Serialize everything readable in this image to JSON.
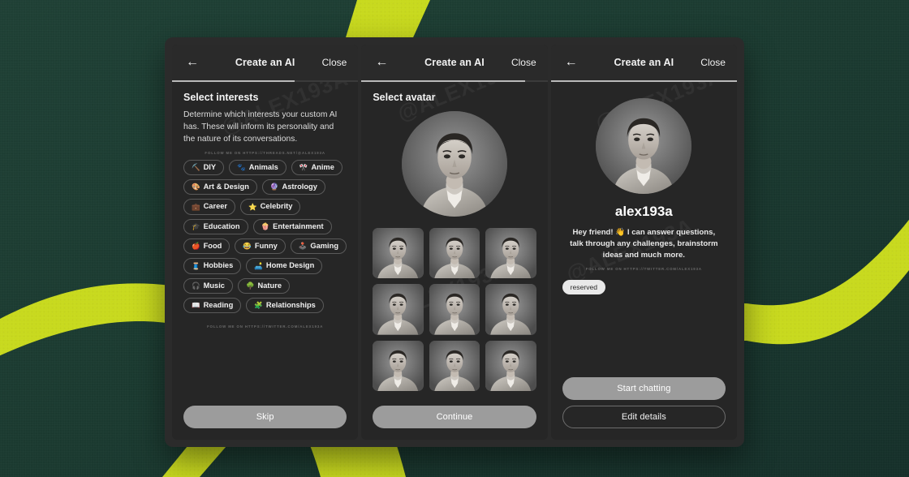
{
  "background": {
    "color": "#1d3b32",
    "ribbon_color": "#c8d91e"
  },
  "watermarks": {
    "threads": "FOLLOW ME ON HTTPS://THREADS.NET/@ALEX193A",
    "twitter": "FOLLOW ME ON HTTPS://TWITTER.COM/ALEX193A",
    "handle": "@ALEX193A"
  },
  "screens": [
    {
      "header": {
        "back_icon": "arrow-left-icon",
        "back_glyph": "←",
        "title": "Create an AI",
        "close_label": "Close"
      },
      "progress_percent": 66,
      "section_title": "Select interests",
      "section_desc": "Determine which interests your custom AI has. These will inform its personality and the nature of its conversations.",
      "interests": [
        {
          "emoji": "⛏️",
          "label": "DIY",
          "icon": "diy-icon"
        },
        {
          "emoji": "🐾",
          "label": "Animals",
          "icon": "animals-icon"
        },
        {
          "emoji": "🎌",
          "label": "Anime",
          "icon": "anime-icon"
        },
        {
          "emoji": "🎨",
          "label": "Art & Design",
          "icon": "art-design-icon"
        },
        {
          "emoji": "🔮",
          "label": "Astrology",
          "icon": "astrology-icon"
        },
        {
          "emoji": "💼",
          "label": "Career",
          "icon": "career-icon"
        },
        {
          "emoji": "⭐",
          "label": "Celebrity",
          "icon": "celebrity-icon"
        },
        {
          "emoji": "🎓",
          "label": "Education",
          "icon": "education-icon"
        },
        {
          "emoji": "🍿",
          "label": "Entertainment",
          "icon": "entertainment-icon"
        },
        {
          "emoji": "🍎",
          "label": "Food",
          "icon": "food-icon"
        },
        {
          "emoji": "😂",
          "label": "Funny",
          "icon": "funny-icon"
        },
        {
          "emoji": "🕹️",
          "label": "Gaming",
          "icon": "gaming-icon"
        },
        {
          "emoji": "🧵",
          "label": "Hobbies",
          "icon": "hobbies-icon"
        },
        {
          "emoji": "🛋️",
          "label": "Home Design",
          "icon": "home-design-icon"
        },
        {
          "emoji": "🎧",
          "label": "Music",
          "icon": "music-icon"
        },
        {
          "emoji": "🌳",
          "label": "Nature",
          "icon": "nature-icon"
        },
        {
          "emoji": "📖",
          "label": "Reading",
          "icon": "reading-icon"
        },
        {
          "emoji": "🧩",
          "label": "Relationships",
          "icon": "relationships-icon"
        }
      ],
      "primary_button": "Skip"
    },
    {
      "header": {
        "back_icon": "arrow-left-icon",
        "back_glyph": "←",
        "title": "Create an AI",
        "close_label": "Close"
      },
      "progress_percent": 88,
      "section_title": "Select avatar",
      "avatar_count": 9,
      "primary_button": "Continue"
    },
    {
      "header": {
        "back_icon": "arrow-left-icon",
        "back_glyph": "←",
        "title": "Create an AI",
        "close_label": "Close"
      },
      "progress_percent": 100,
      "profile_name": "alex193a",
      "profile_bio": "Hey friend! 👋 I can answer questions, talk through any challenges, brainstorm ideas and much more.",
      "badge_label": "reserved",
      "primary_button": "Start chatting",
      "secondary_button": "Edit details"
    }
  ]
}
